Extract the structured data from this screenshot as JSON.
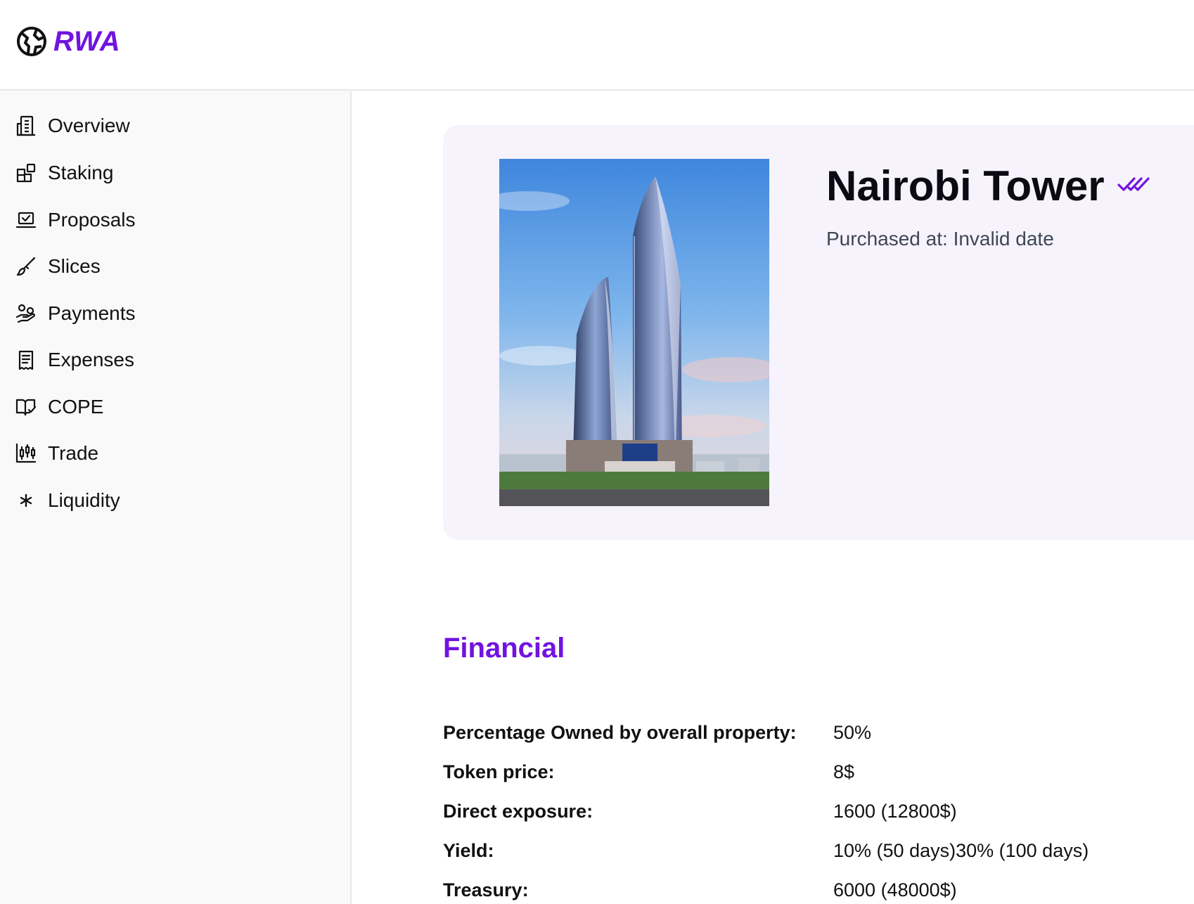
{
  "header": {
    "brand": "RWA"
  },
  "sidebar": {
    "items": [
      {
        "label": "Overview",
        "icon": "building-icon"
      },
      {
        "label": "Staking",
        "icon": "blocks-icon"
      },
      {
        "label": "Proposals",
        "icon": "laptop-check-icon"
      },
      {
        "label": "Slices",
        "icon": "brush-icon"
      },
      {
        "label": "Payments",
        "icon": "hand-coins-icon"
      },
      {
        "label": "Expenses",
        "icon": "receipt-icon"
      },
      {
        "label": "COPE",
        "icon": "book-check-icon"
      },
      {
        "label": "Trade",
        "icon": "candlestick-chart-icon"
      },
      {
        "label": "Liquidity",
        "icon": "asterisk-icon"
      }
    ]
  },
  "property": {
    "name": "Nairobi Tower",
    "verified_icon": "double-check-icon",
    "purchased_label": "Purchased at:",
    "purchased_value": "Invalid date"
  },
  "financial": {
    "title": "Financial",
    "rows": [
      {
        "label": "Percentage Owned by overall property:",
        "value": "50%"
      },
      {
        "label": "Token price:",
        "value": "8$"
      },
      {
        "label": "Direct exposure:",
        "value": "1600 (12800$)"
      },
      {
        "label": "Yield:",
        "value": "10% (50 days)30% (100 days)"
      },
      {
        "label": "Treasury:",
        "value": "6000 (48000$)"
      }
    ]
  },
  "colors": {
    "accent": "#7113e0",
    "hero_bg": "#f6f3fd",
    "sidebar_bg": "#f9f9f9",
    "border": "#e6e6e6"
  }
}
